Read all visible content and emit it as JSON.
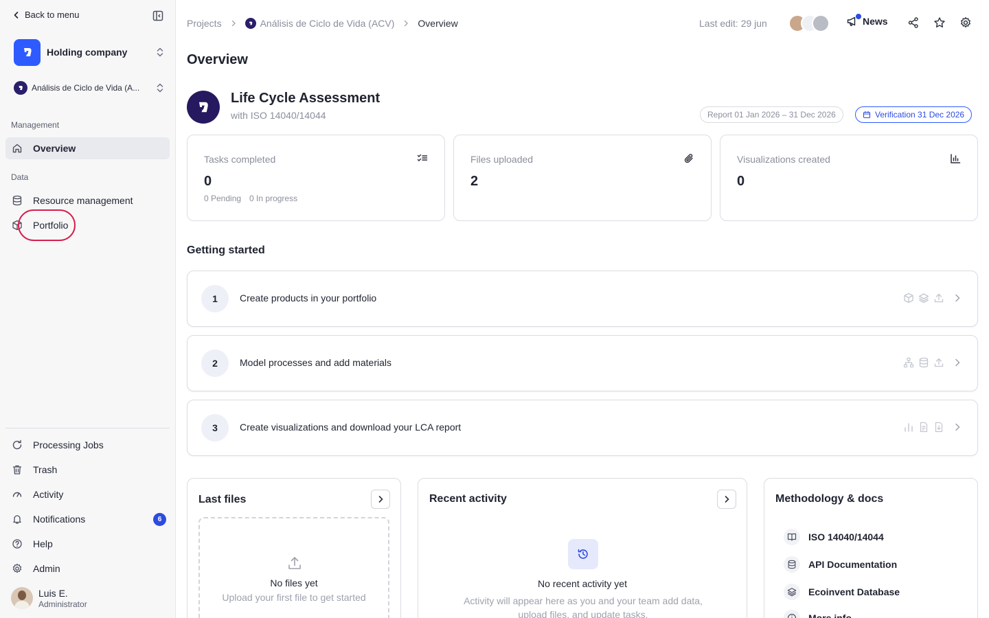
{
  "sidebar": {
    "back_label": "Back to menu",
    "org_name": "Holding company",
    "project_name": "Análisis de Ciclo de Vida (A...",
    "sections": {
      "management": "Management",
      "data": "Data"
    },
    "items": {
      "overview": "Overview",
      "resource_management": "Resource management",
      "portfolio": "Portfolio",
      "processing_jobs": "Processing Jobs",
      "trash": "Trash",
      "activity": "Activity",
      "notifications": "Notifications",
      "help": "Help",
      "admin": "Admin"
    },
    "notifications_count": "6",
    "user": {
      "name": "Luis E.",
      "role": "Administrator"
    }
  },
  "topbar": {
    "breadcrumbs": [
      "Projects",
      "Análisis de Ciclo de Vida (ACV)",
      "Overview"
    ],
    "last_edit": "Last edit: 29 jun",
    "news_label": "News"
  },
  "main": {
    "title": "Overview",
    "project": {
      "title": "Life Cycle Assessment",
      "subtitle": "with ISO 14040/14044",
      "report_period": "Report 01 Jan 2026 – 31 Dec 2026",
      "verification": "Verification 31 Dec 2026"
    },
    "stats": [
      {
        "label": "Tasks completed",
        "value": "0",
        "icon": "tasks-icon",
        "sub": [
          "0 Pending",
          "0 In progress"
        ]
      },
      {
        "label": "Files uploaded",
        "value": "2",
        "icon": "paperclip-icon"
      },
      {
        "label": "Visualizations created",
        "value": "0",
        "icon": "bar-chart-icon"
      }
    ],
    "getting_started": {
      "title": "Getting started",
      "steps": [
        {
          "num": "1",
          "text": "Create products in your portfolio"
        },
        {
          "num": "2",
          "text": "Model processes and add materials"
        },
        {
          "num": "3",
          "text": "Create visualizations and download your LCA report"
        }
      ]
    },
    "last_files": {
      "title": "Last files",
      "empty_title": "No files yet",
      "empty_sub": "Upload your first file to get started"
    },
    "recent_activity": {
      "title": "Recent activity",
      "empty_title": "No recent activity yet",
      "empty_sub": "Activity will appear here as you and your team add data, upload files, and update tasks."
    },
    "docs": {
      "title": "Methodology & docs",
      "items": [
        "ISO 14040/14044",
        "API Documentation",
        "Ecoinvent Database",
        "More info"
      ]
    }
  },
  "colors": {
    "accent": "#2d5bff",
    "badge": "#2d4be0",
    "project_logo": "#26195f",
    "highlight": "#d61f4a"
  }
}
